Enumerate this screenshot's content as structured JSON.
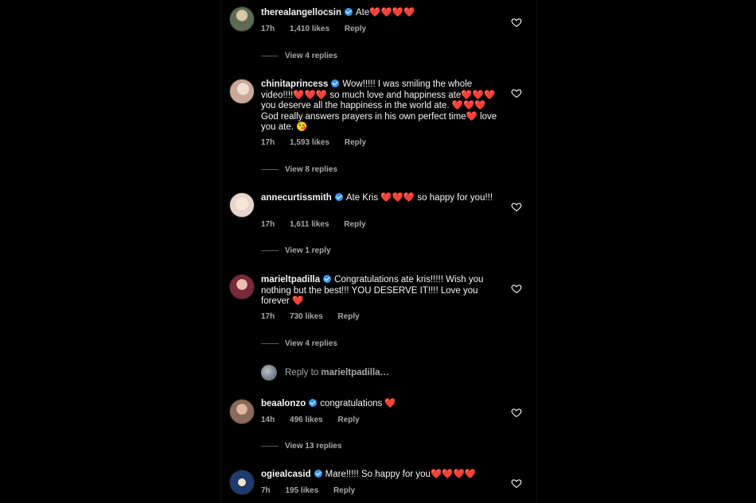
{
  "comments": [
    {
      "username": "therealangellocsin",
      "text": "Ate",
      "hearts": "❤️❤️❤️❤️",
      "tail": "",
      "time": "17h",
      "likes": "1,410 likes",
      "reply_label": "Reply",
      "view_replies": "View 4 replies",
      "avatar_color": "#5d6b55"
    },
    {
      "username": "chinitaprincess",
      "text": "Wow!!!!! I was smiling the whole video!!!!❤️❤️❤️ so much love and happiness ate❤️❤️❤️ you deserve all the happiness in the world ate. ❤️❤️❤️ God really answers prayers in his own perfect time❤️ love you ate. 😘",
      "hearts": "",
      "tail": "",
      "time": "17h",
      "likes": "1,593 likes",
      "reply_label": "Reply",
      "view_replies": "View 8 replies",
      "avatar_color": "#c9a89a"
    },
    {
      "username": "annecurtissmith",
      "text": "Ate Kris ❤️❤️❤️ so happy for you!!!",
      "hearts": "",
      "tail": "",
      "time": "17h",
      "likes": "1,611 likes",
      "reply_label": "Reply",
      "view_replies": "View 1 reply",
      "avatar_color": "#e8d5cc"
    },
    {
      "username": "marieltpadilla",
      "text": "Congratulations ate kris!!!!! Wish you nothing but the best!!! YOU DESERVE IT!!!! Love you forever ❤️",
      "hearts": "",
      "tail": "",
      "time": "17h",
      "likes": "730 likes",
      "reply_label": "Reply",
      "view_replies": "View 4 replies",
      "avatar_color": "#7a2a3a"
    },
    {
      "username": "beaalonzo",
      "text": "congratulations ❤️",
      "hearts": "",
      "tail": "",
      "time": "14h",
      "likes": "496 likes",
      "reply_label": "Reply",
      "view_replies": "View 13 replies",
      "avatar_color": "#8a6a5a"
    },
    {
      "username": "ogiealcasid",
      "text": "Mare!!!!! So happy for you❤️❤️❤️❤️",
      "hearts": "",
      "tail": "",
      "time": "7h",
      "likes": "195 likes",
      "reply_label": "Reply",
      "view_replies": "",
      "avatar_color": "#1e3a6e"
    }
  ],
  "reply_to": {
    "prefix": "Reply to",
    "username": "marieltpadilla…"
  },
  "colors": {
    "background": "#000000",
    "text": "#f5f5f5",
    "muted": "#a8a8a8",
    "verified": "#3897f0",
    "heart": "#ed1c24"
  },
  "icons": {
    "like": "heart-outline-icon",
    "verified": "verified-badge-icon"
  }
}
